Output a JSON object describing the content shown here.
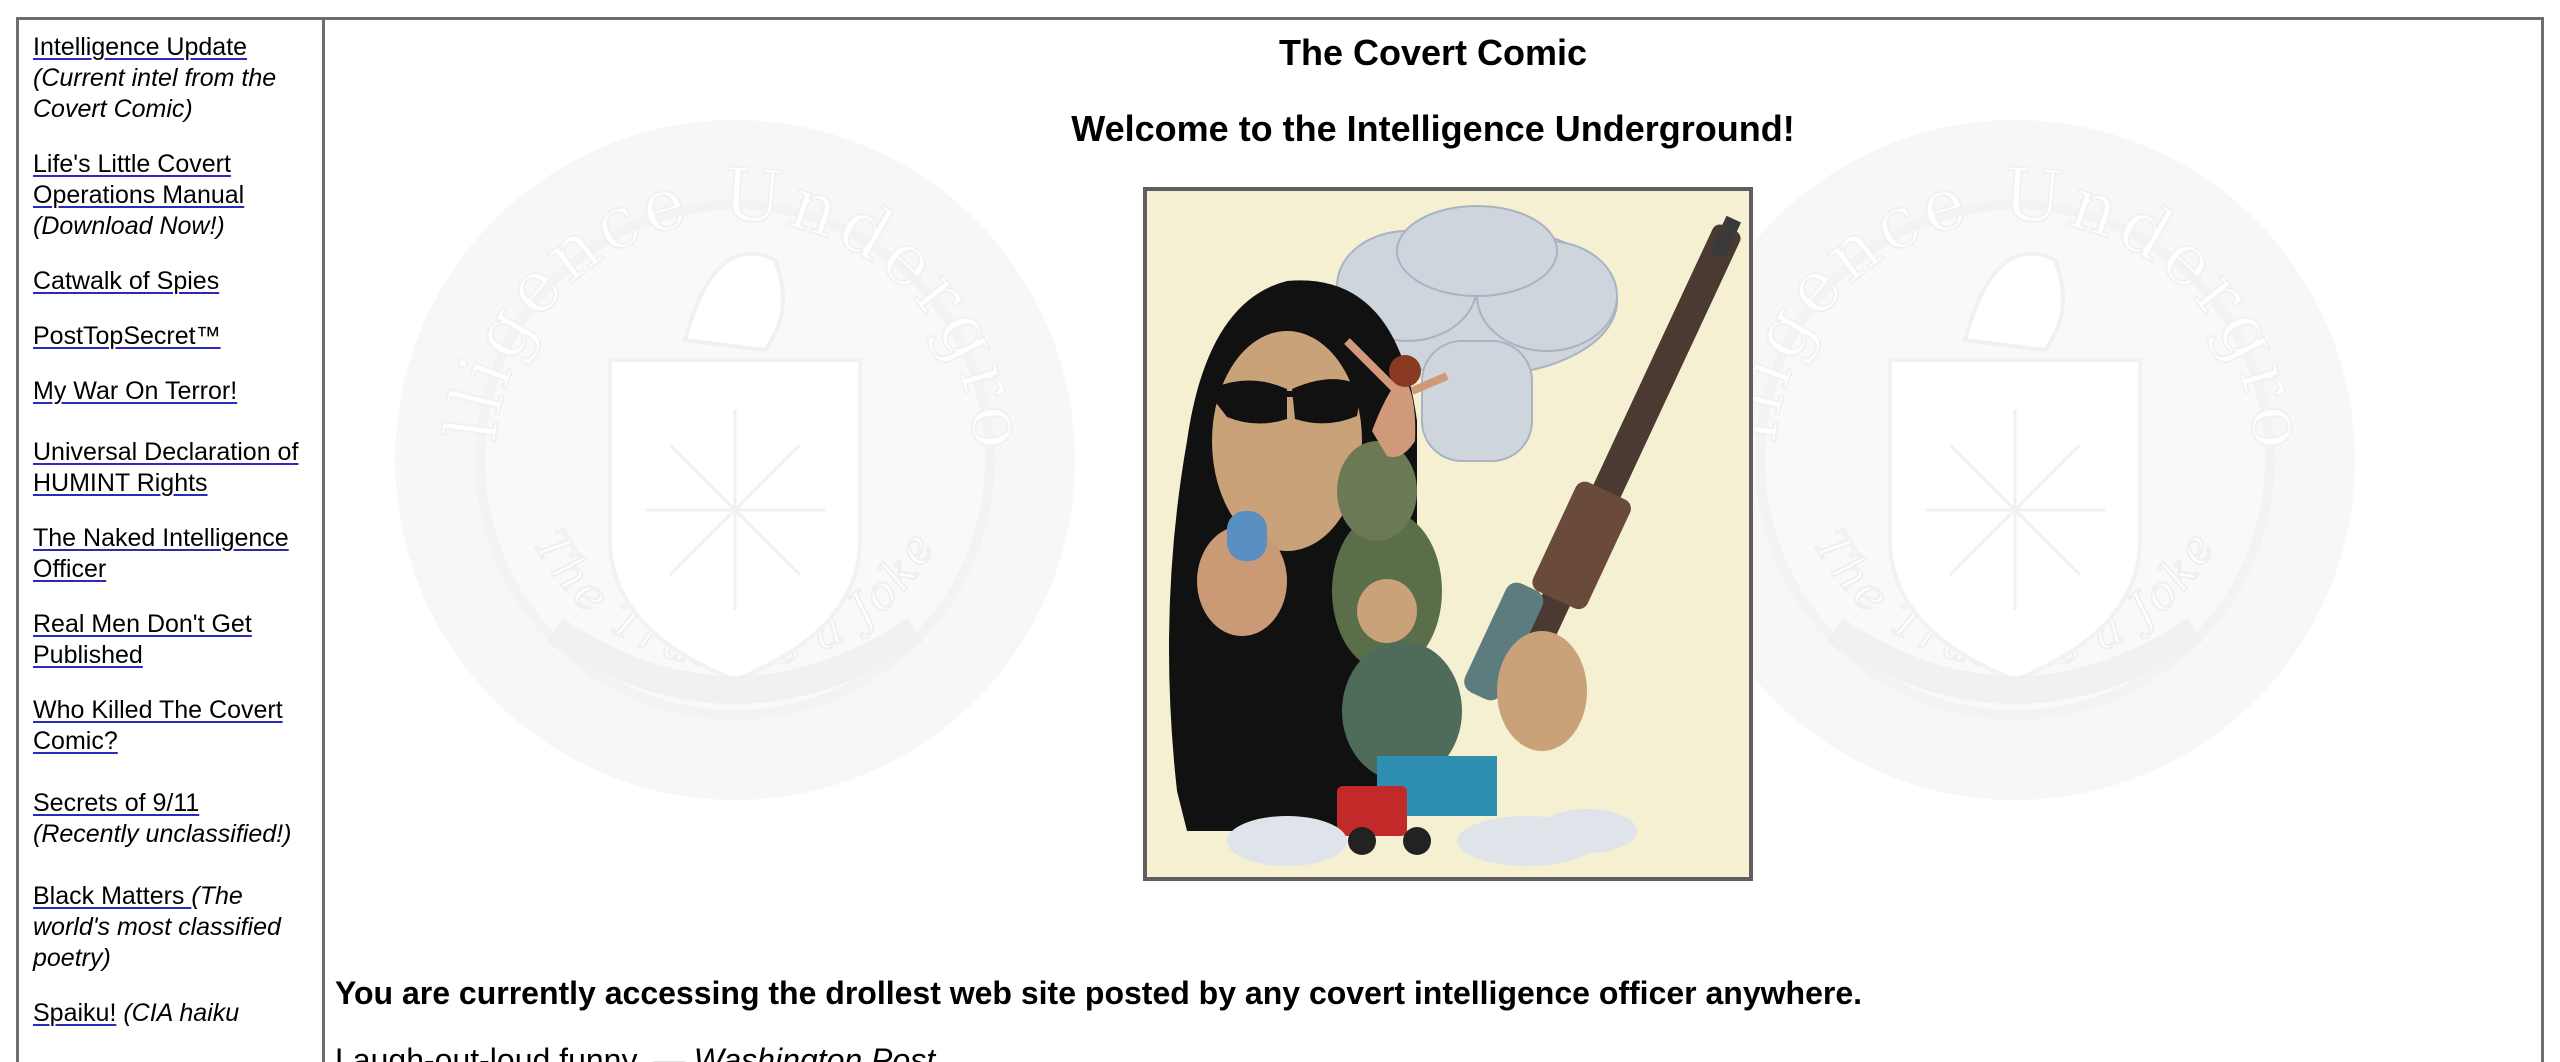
{
  "site": {
    "title": "The Covert Comic",
    "welcome": "Welcome to the Intelligence Underground!"
  },
  "sidebar": {
    "items": [
      {
        "label": "Intelligence Update",
        "note": "(Current intel from the Covert Comic)"
      },
      {
        "label": "Life's Little Covert Operations Manual",
        "note": "(Download Now!)"
      },
      {
        "label": "Catwalk of Spies",
        "note": ""
      },
      {
        "label": "PostTopSecret™",
        "note": ""
      },
      {
        "label": "My War On Terror!",
        "note": ""
      },
      {
        "label": "Universal Declaration of HUMINT Rights",
        "note": ""
      },
      {
        "label": "The Naked Intelligence Officer",
        "note": ""
      },
      {
        "label": "Real Men Don't Get Published",
        "note": ""
      },
      {
        "label": "Who Killed The Covert Comic?",
        "note": ""
      },
      {
        "label": "Secrets of 9/11",
        "note": "(Recently unclassified!)"
      },
      {
        "label": "Black Matters ",
        "note": "(The world's most classified poetry)"
      },
      {
        "label": "Spaiku!",
        "note": "(CIA haiku"
      }
    ]
  },
  "watermark": {
    "top_text": "Intelligence Underground",
    "bottom_text": "The Truth is a Joke"
  },
  "main": {
    "tagline": "You are currently accessing the drollest web site posted by any covert intelligence officer anywhere.",
    "quote_text": "Laugh-out-loud funny. — ",
    "quote_source": "Washington Post"
  },
  "colors": {
    "border": "#6e6e6e",
    "link_underline": "#2b2bb8",
    "hero_background": "#f6f0d2"
  },
  "icons": {
    "watermark": "cia-seal-icon",
    "hero": "spy-collage-illustration"
  }
}
